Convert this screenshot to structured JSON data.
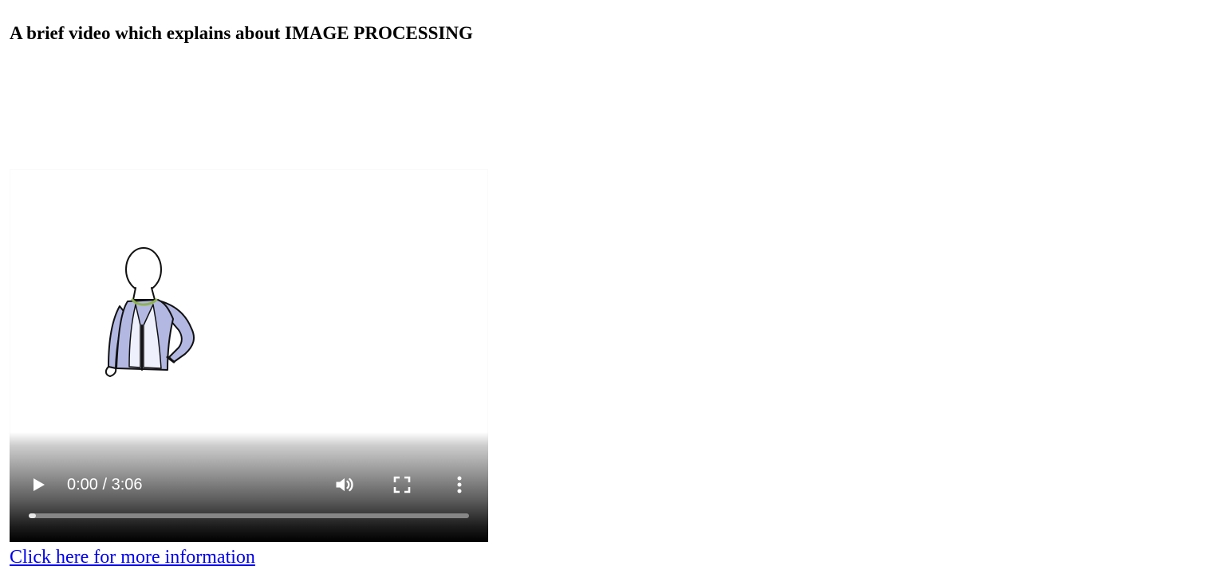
{
  "page": {
    "heading": "A brief video which explains about IMAGE PROCESSING",
    "link_text": "Click here for more information"
  },
  "video": {
    "time_display": "0:00 / 3:06",
    "progress_fraction": 0.0,
    "icons": {
      "play": "play-icon",
      "volume": "volume-icon",
      "fullscreen": "fullscreen-icon",
      "more": "more-vert-icon"
    },
    "frame_illustration": "person-in-cardigan",
    "colors": {
      "control_text": "#ffffff",
      "cardigan": "#b3b8e3",
      "collar": "#bcd98a",
      "link": "#0000ee"
    }
  }
}
